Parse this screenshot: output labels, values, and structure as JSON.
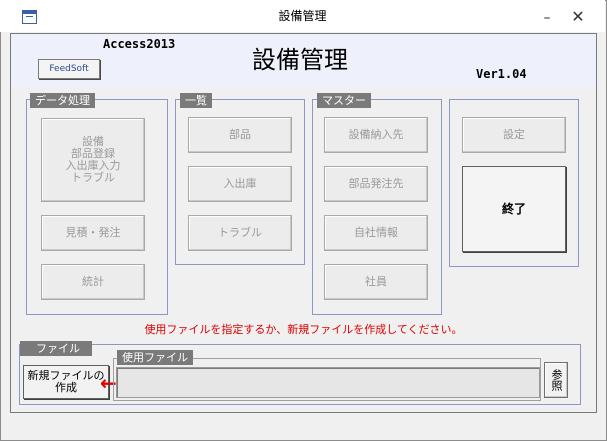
{
  "window": {
    "title": "設備管理",
    "minimize": "–",
    "close": "✕"
  },
  "header": {
    "access": "Access2013",
    "feedsoft": "FeedSoft",
    "title": "設備管理",
    "version": "Ver1.04"
  },
  "groups": {
    "data_processing": {
      "label": "データ処理",
      "equip_lines": [
        "設備",
        "部品登録",
        "入出庫入力",
        "トラブル"
      ],
      "estimate": "見積・発注",
      "stats": "統計"
    },
    "list": {
      "label": "一覧",
      "parts": "部品",
      "inout": "入出庫",
      "trouble": "トラブル"
    },
    "master": {
      "label": "マスター",
      "supplier": "設備納入先",
      "parts_supplier": "部品発注先",
      "company": "自社情報",
      "staff": "社員"
    },
    "misc": {
      "settings": "設定",
      "exit": "終了"
    }
  },
  "message": "使用ファイルを指定するか、新規ファイルを作成してください。",
  "file": {
    "label": "ファイル",
    "new_line1": "新規ファイルの",
    "new_line2": "作成",
    "arrow": "←",
    "used_label": "使用ファイル",
    "value": "",
    "browse": "参照"
  },
  "colors": {
    "accent_red": "#e00000",
    "group_border": "#8c96c8",
    "label_bg": "#7a7a7a"
  }
}
